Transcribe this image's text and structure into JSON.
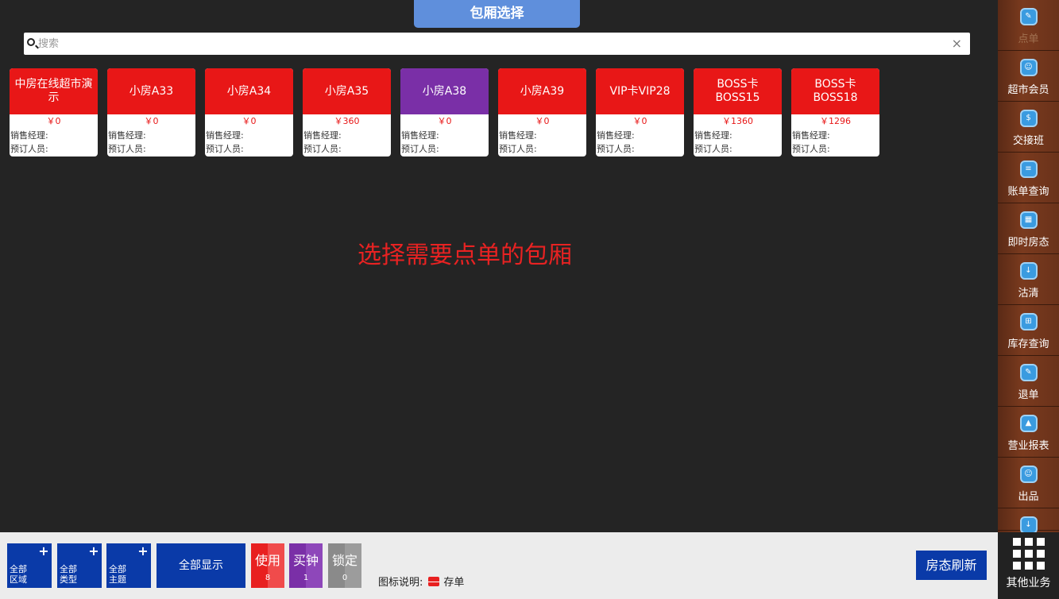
{
  "header": {
    "title": "包厢选择"
  },
  "search": {
    "placeholder": "搜索",
    "clear_glyph": "×"
  },
  "rooms": [
    {
      "name": "中房在线超市演示",
      "price": "￥0",
      "manager_label": "销售经理:",
      "booker_label": "预订人员:",
      "status_color": "#e81717"
    },
    {
      "name": "小房A33",
      "price": "￥0",
      "manager_label": "销售经理:",
      "booker_label": "预订人员:",
      "status_color": "#e81717"
    },
    {
      "name": "小房A34",
      "price": "￥0",
      "manager_label": "销售经理:",
      "booker_label": "预订人员:",
      "status_color": "#e81717"
    },
    {
      "name": "小房A35",
      "price": "￥360",
      "manager_label": "销售经理:",
      "booker_label": "预订人员:",
      "status_color": "#e81717"
    },
    {
      "name": "小房A38",
      "price": "￥0",
      "manager_label": "销售经理:",
      "booker_label": "预订人员:",
      "status_color": "#7a2fa7"
    },
    {
      "name": "小房A39",
      "price": "￥0",
      "manager_label": "销售经理:",
      "booker_label": "预订人员:",
      "status_color": "#e81717"
    },
    {
      "name": "VIP卡VIP28",
      "price": "￥0",
      "manager_label": "销售经理:",
      "booker_label": "预订人员:",
      "status_color": "#e81717"
    },
    {
      "name": "BOSS卡BOSS15",
      "price": "￥1360",
      "manager_label": "销售经理:",
      "booker_label": "预订人员:",
      "status_color": "#e81717"
    },
    {
      "name": "BOSS卡BOSS18",
      "price": "￥1296",
      "manager_label": "销售经理:",
      "booker_label": "预订人员:",
      "status_color": "#e81717"
    }
  ],
  "hint": "选择需要点单的包厢",
  "sidebar": {
    "items": [
      {
        "label": "点单",
        "icon": "order-icon"
      },
      {
        "label": "超市会员",
        "icon": "member-icon"
      },
      {
        "label": "交接班",
        "icon": "shift-icon"
      },
      {
        "label": "账单查询",
        "icon": "bill-icon"
      },
      {
        "label": "即时房态",
        "icon": "room-status-icon"
      },
      {
        "label": "沽清",
        "icon": "sold-out-icon"
      },
      {
        "label": "库存查询",
        "icon": "inventory-icon"
      },
      {
        "label": "退单",
        "icon": "refund-icon"
      },
      {
        "label": "营业报表",
        "icon": "report-icon"
      },
      {
        "label": "出品",
        "icon": "dispatch-icon"
      }
    ],
    "other_label": "其他业务"
  },
  "footer": {
    "filters": [
      {
        "label_line1": "全部",
        "label_line2": "区域",
        "plus": "+"
      },
      {
        "label_line1": "全部",
        "label_line2": "类型",
        "plus": "+"
      },
      {
        "label_line1": "全部",
        "label_line2": "主题",
        "plus": "+"
      }
    ],
    "show_all": "全部显示",
    "legend": [
      {
        "label": "使用",
        "count": "8",
        "color": "#e82020"
      },
      {
        "label": "买钟",
        "count": "1",
        "color": "#7a2fa7"
      },
      {
        "label": "锁定",
        "count": "0",
        "color": "#8a8a8a"
      }
    ],
    "icon_legend_label": "图标说明:",
    "icon_legend_item": "存单",
    "refresh": "房态刷新"
  }
}
